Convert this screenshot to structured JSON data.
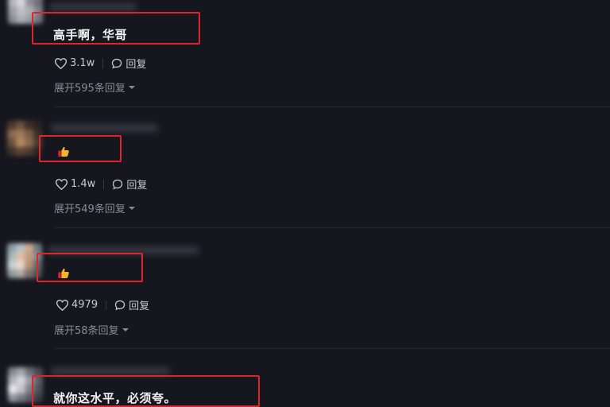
{
  "comments": [
    {
      "text": "高手啊，华哥",
      "likes": "3.1w",
      "reply_label": "回复",
      "expand_label": "展开595条回复"
    },
    {
      "text": "",
      "emoji": "thumbs-up-emoji",
      "likes": "1.4w",
      "reply_label": "回复",
      "expand_label": "展开549条回复"
    },
    {
      "text": "",
      "emoji": "thumbs-up-emoji",
      "likes": "4979",
      "reply_label": "回复",
      "expand_label": "展开58条回复"
    },
    {
      "text": "就你这水平，必须夸。"
    }
  ],
  "colors": {
    "background": "#16161e",
    "highlight": "#e0242b",
    "text": "#f2f2f4",
    "muted": "#8a8a94"
  }
}
